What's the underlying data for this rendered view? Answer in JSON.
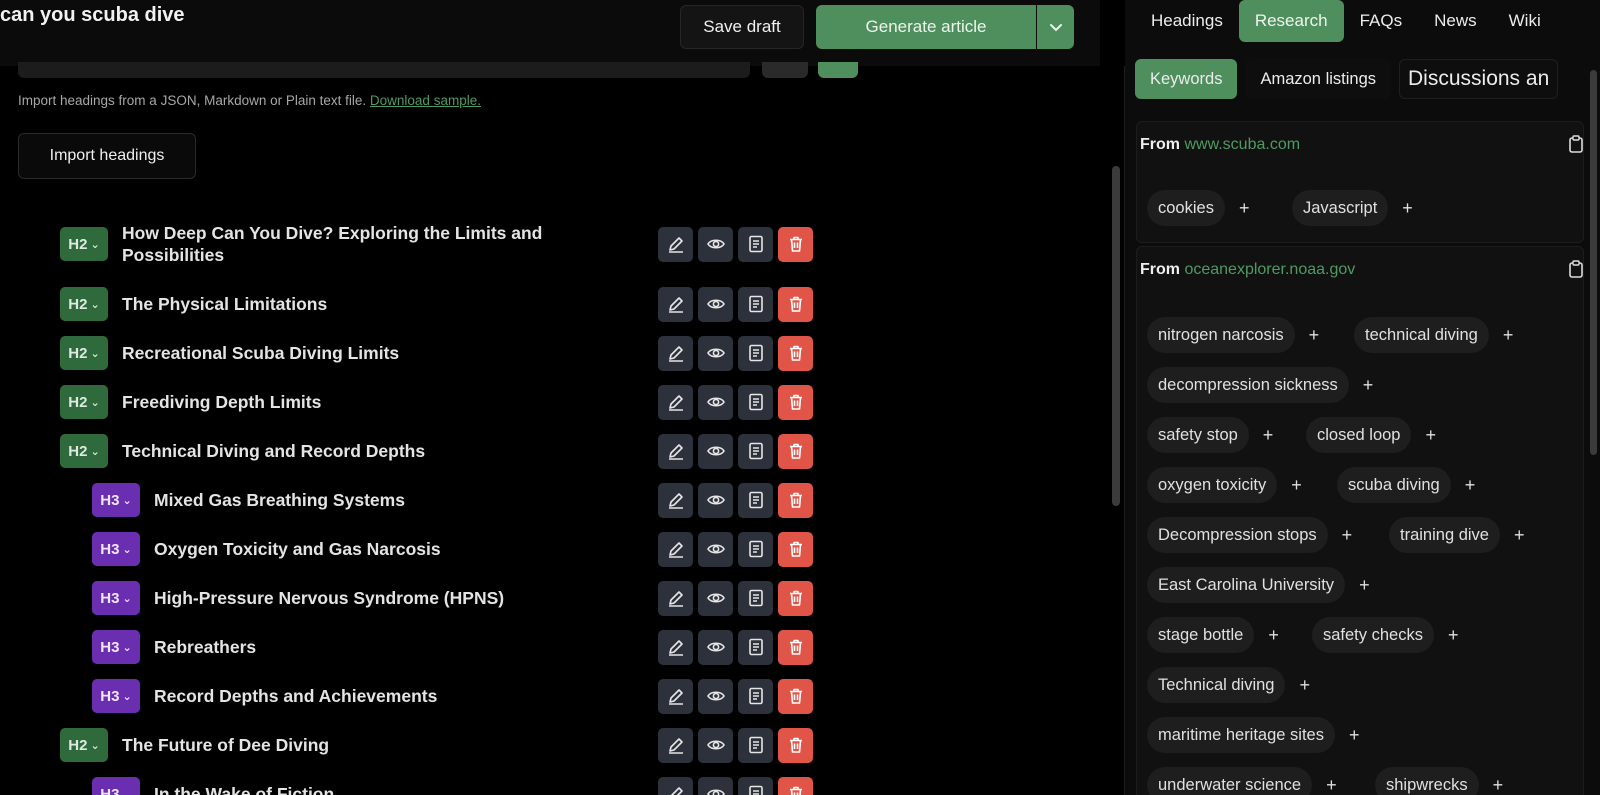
{
  "header": {
    "title": "can you scuba dive",
    "save_label": "Save draft",
    "generate_label": "Generate article"
  },
  "import": {
    "hint": "Import headings from a JSON, Markdown or Plain text file.",
    "link": "Download sample.",
    "button": "Import headings"
  },
  "headings": [
    {
      "level": "H2",
      "text": "How Deep Can You Dive? Exploring the Limits and Possibilities"
    },
    {
      "level": "H2",
      "text": "The Physical Limitations"
    },
    {
      "level": "H2",
      "text": "Recreational Scuba Diving Limits"
    },
    {
      "level": "H2",
      "text": "Freediving Depth Limits"
    },
    {
      "level": "H2",
      "text": "Technical Diving and Record Depths"
    },
    {
      "level": "H3",
      "text": "Mixed Gas Breathing Systems"
    },
    {
      "level": "H3",
      "text": "Oxygen Toxicity and Gas Narcosis"
    },
    {
      "level": "H3",
      "text": "High-Pressure Nervous Syndrome (HPNS)"
    },
    {
      "level": "H3",
      "text": "Rebreathers"
    },
    {
      "level": "H3",
      "text": "Record Depths and Achievements"
    },
    {
      "level": "H2",
      "text": "The Future of Dee Diving"
    },
    {
      "level": "H3",
      "text": "In the Wake of Fiction"
    }
  ],
  "right_panel": {
    "tabs": [
      "Headings",
      "Research",
      "FAQs",
      "News",
      "Wiki"
    ],
    "active_tab": "Research",
    "subtabs": [
      "Keywords",
      "Amazon listings",
      "Discussions an"
    ],
    "active_subtab": "Keywords",
    "sources": [
      {
        "prefix": "From",
        "domain": "www.scuba.com",
        "keywords": [
          "cookies",
          "Javascript"
        ]
      },
      {
        "prefix": "From",
        "domain": "oceanexplorer.noaa.gov",
        "keywords": [
          "nitrogen narcosis",
          "technical diving",
          "decompression sickness",
          "safety stop",
          "closed loop",
          "oxygen toxicity",
          "scuba diving",
          "Decompression stops",
          "training dive",
          "East Carolina University",
          "stage bottle",
          "safety checks",
          "Technical diving",
          "maritime heritage sites",
          "underwater science",
          "shipwrecks"
        ]
      }
    ]
  },
  "icons": {
    "edit": "pencil-icon",
    "view": "eye-icon",
    "content": "document-icon",
    "delete": "trash-icon",
    "clipboard": "clipboard-icon",
    "dropdown": "chevron-down-icon"
  },
  "colors": {
    "accent_green": "#4f8f5e",
    "h2_badge": "#2f6a3c",
    "h3_badge": "#6a2fb0",
    "delete_red": "#e05548"
  }
}
